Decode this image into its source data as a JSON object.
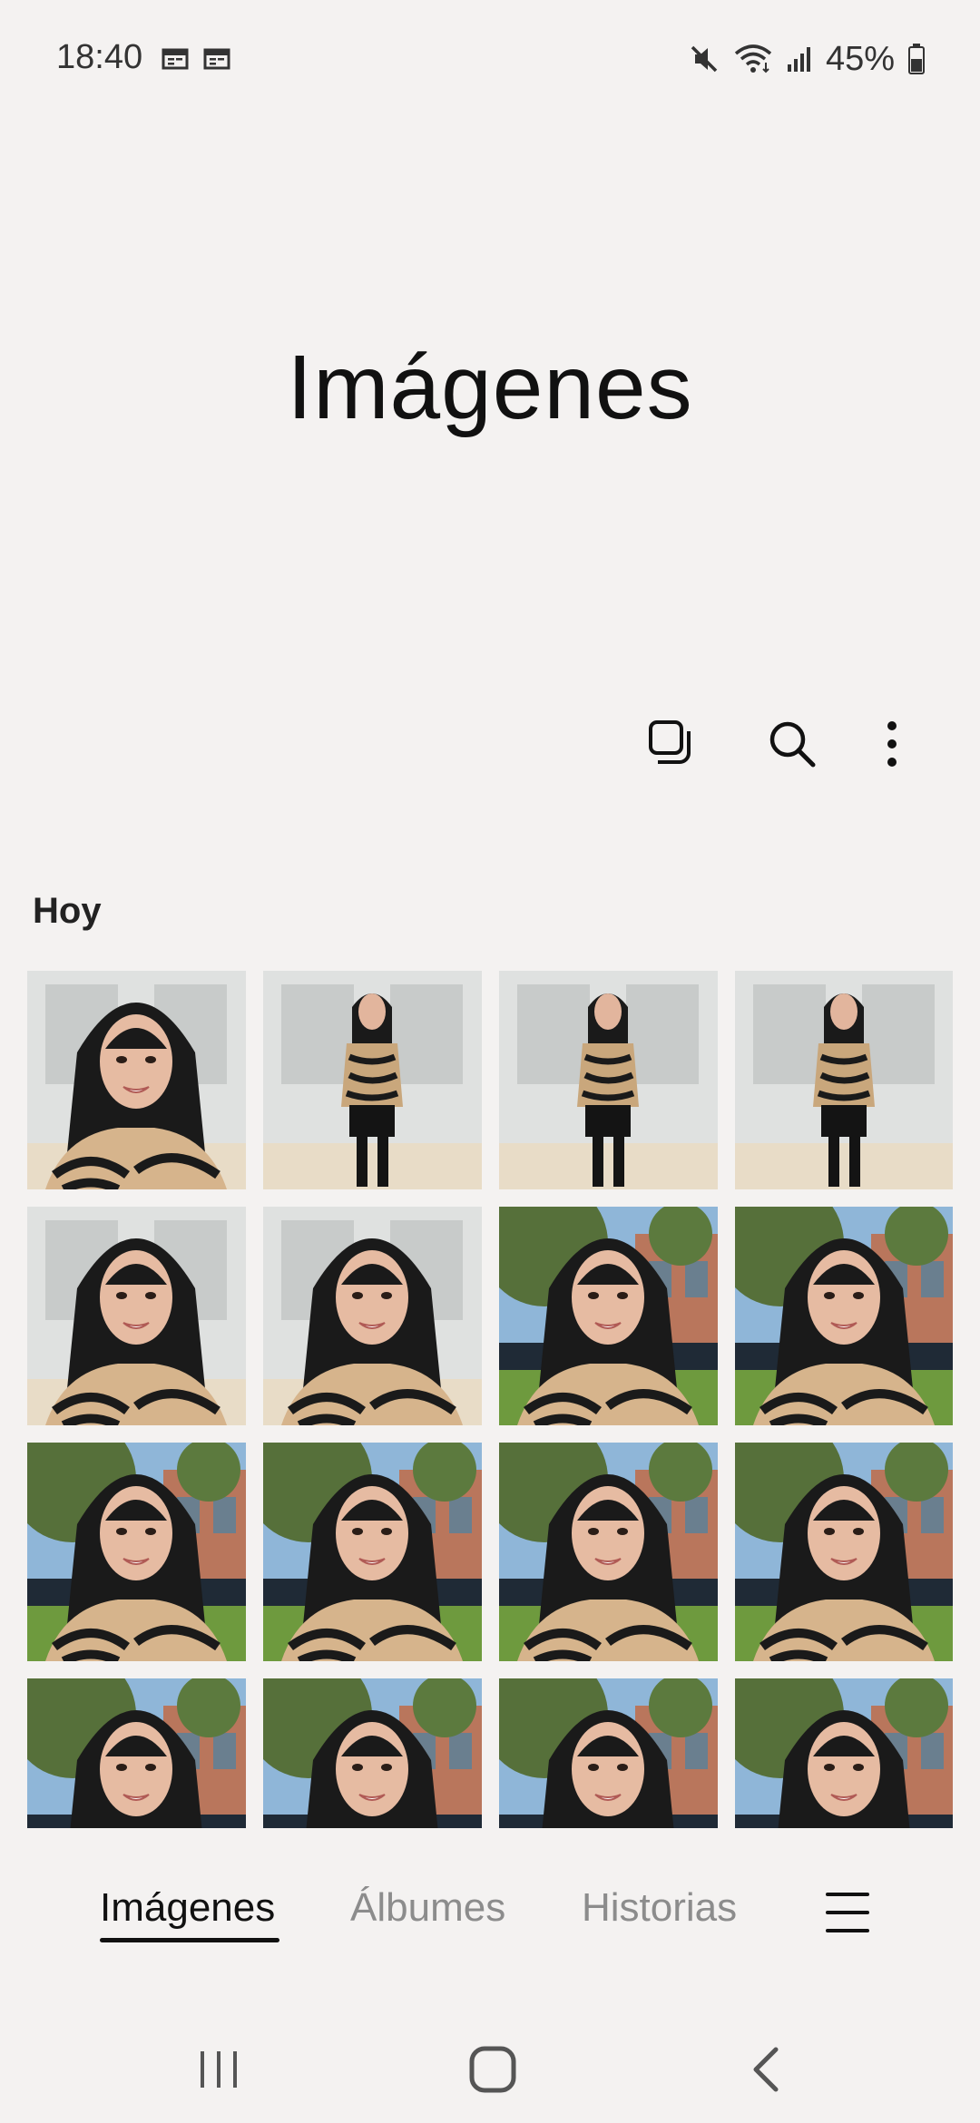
{
  "status_bar": {
    "time": "18:40",
    "notification_icons": [
      "calendar-icon",
      "calendar-icon"
    ],
    "icons": [
      "mute-icon",
      "wifi-icon",
      "signal-icon",
      "battery-icon"
    ],
    "battery": "45%"
  },
  "header": {
    "title": "Imágenes"
  },
  "toolbar": {
    "icons": [
      "select-multiple-icon",
      "search-icon",
      "more-options-icon"
    ]
  },
  "section": {
    "label": "Hoy"
  },
  "gallery": {
    "rows": 4,
    "columns": 4,
    "items": [
      {
        "type": "portrait-indoor"
      },
      {
        "type": "full-indoor"
      },
      {
        "type": "full-body-indoor"
      },
      {
        "type": "full-body-indoor"
      },
      {
        "type": "portrait-indoor"
      },
      {
        "type": "portrait-indoor"
      },
      {
        "type": "selfie-outdoor"
      },
      {
        "type": "selfie-outdoor"
      },
      {
        "type": "selfie-outdoor"
      },
      {
        "type": "selfie-outdoor"
      },
      {
        "type": "selfie-outdoor"
      },
      {
        "type": "selfie-outdoor"
      },
      {
        "type": "selfie-outdoor"
      },
      {
        "type": "selfie-outdoor"
      },
      {
        "type": "selfie-outdoor"
      },
      {
        "type": "selfie-outdoor"
      }
    ]
  },
  "bottom_tabs": [
    {
      "label": "Imágenes",
      "active": true
    },
    {
      "label": "Álbumes",
      "active": false
    },
    {
      "label": "Historias",
      "active": false
    }
  ],
  "bottom_menu_icon": "hamburger-menu-icon",
  "navigation": {
    "icons": [
      "recent-apps-icon",
      "home-icon",
      "back-icon"
    ]
  },
  "colors": {
    "background": "#f4f2f1",
    "text": "#111111",
    "inactive_tab": "#8c8c8c"
  }
}
